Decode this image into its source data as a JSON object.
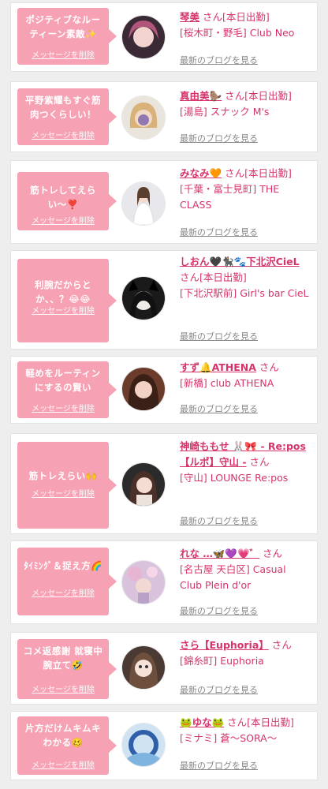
{
  "delete_label": "メッセージを削除",
  "blog_label": "最新のブログを見る",
  "accent_color": "#d6336c",
  "bubble_color": "#f7a2b4",
  "cards": [
    {
      "message": "ポジティブなルーティーン素敵✨",
      "name": "琴美",
      "suffix": "さん[本日出勤]",
      "shop": "[桜木町・野毛] Club Neo"
    },
    {
      "message": "平野紫耀もすぐ筋肉つくらしい！",
      "name": "真由美🦫",
      "suffix": "さん[本日出勤]",
      "shop": "[湯島] スナック M's"
    },
    {
      "message": "筋トレしてえらい〜❣️",
      "name": "みなみ🧡",
      "suffix": "さん[本日出勤]",
      "shop": "[千葉・富士見町] THE CLASS"
    },
    {
      "message": "利腕だからとか、、？😂😂",
      "name": "しおん🖤🐈‍⬛🐾下北沢CieL",
      "suffix": "さん[本日出勤]",
      "shop": "[下北沢駅前] Girl's bar CieL"
    },
    {
      "message": "軽めをルーティンにするの賢い",
      "name": "すず🔔ATHENA",
      "suffix": "さん",
      "shop": "[新橋] club ATHENA"
    },
    {
      "message": "筋トレえらい🙌",
      "name": "神崎ももせ 🐰🎀 - Re:pos 【ルポ】守山 -",
      "suffix": "さん",
      "shop": "[守山] LOUNGE Re:pos"
    },
    {
      "message": "ﾀｲﾐﾝｸﾞ＆捉え方🌈",
      "name": "れな …🦋💜💗゛",
      "suffix": "さん",
      "shop": "[名古屋 天白区] Casual Club Plein d'or"
    },
    {
      "message": "コメ返感謝 就寝中腕立て🤣",
      "name": "さら【Euphoria】",
      "suffix": "さん",
      "shop": "[錦糸町] Euphoria"
    },
    {
      "message": "片方だけムキムキわかる🥴",
      "name": "🐸ゆな🐸",
      "suffix": "さん[本日出勤]",
      "shop": "[ミナミ] 蒼〜SORA〜"
    }
  ]
}
